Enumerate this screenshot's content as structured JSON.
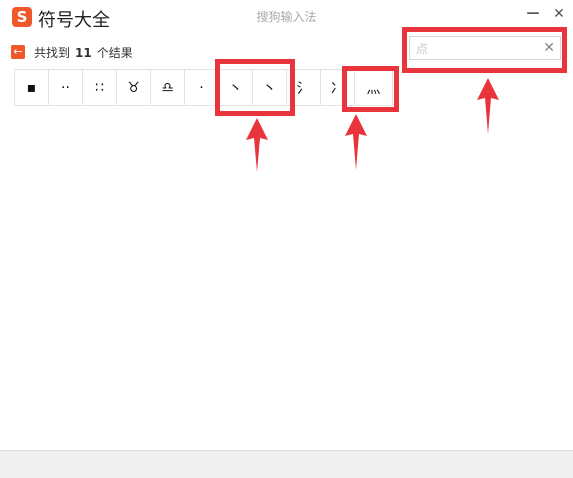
{
  "titlebar": {
    "logo_letter": "S",
    "app_title": "符号大全",
    "window_title": "搜狗输入法",
    "minimize_glyph": "—",
    "close_glyph": "✕"
  },
  "results": {
    "back_glyph": "←",
    "prefix": "共找到",
    "count": "11",
    "suffix": "个结果"
  },
  "search": {
    "value": "点",
    "clear_glyph": "✕"
  },
  "symbols": [
    {
      "char": "▪",
      "name": "symbol-dot"
    },
    {
      "char": "··",
      "name": "symbol-double-dot"
    },
    {
      "char": "∷",
      "name": "symbol-four-dots"
    },
    {
      "char": "♉",
      "name": "symbol-loop-1"
    },
    {
      "char": "♎",
      "name": "symbol-loop-2"
    },
    {
      "char": "·",
      "name": "symbol-middle-dot"
    },
    {
      "char": "丶",
      "name": "symbol-stroke-dot-1"
    },
    {
      "char": "丶",
      "name": "symbol-stroke-dot-2"
    },
    {
      "char": "氵",
      "name": "symbol-radical-1"
    },
    {
      "char": "冫",
      "name": "symbol-radical-2"
    },
    {
      "char": "灬",
      "name": "symbol-fire-dots"
    }
  ],
  "colors": {
    "accent": "#f0572a",
    "highlight": "#e8343a"
  }
}
